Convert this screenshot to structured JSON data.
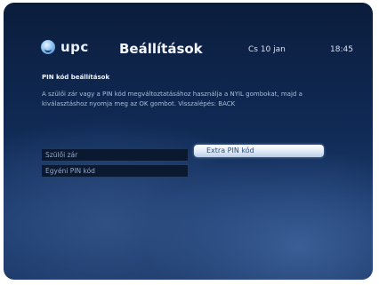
{
  "header": {
    "brand": "upc",
    "title": "Beállítások",
    "date": "Cs 10 jan",
    "time": "18:45"
  },
  "page": {
    "subtitle": "PIN kód beállítások",
    "description": "A szülői zár vagy a PIN kód megváltoztatásához használja a NYIL gombokat, majd a kiválasztáshoz nyomja meg az OK gombot. Visszalépés: BACK"
  },
  "menu": {
    "items": [
      {
        "label": "Szülői zár"
      },
      {
        "label": "Egyéni PIN kód"
      }
    ],
    "submenu_focused": "Extra PIN kód"
  },
  "colors": {
    "background": "#102a55",
    "focus": "#dfe9f6",
    "menu_bg": "#0a1830"
  },
  "icons": {
    "logo": "upc-logo-icon"
  }
}
